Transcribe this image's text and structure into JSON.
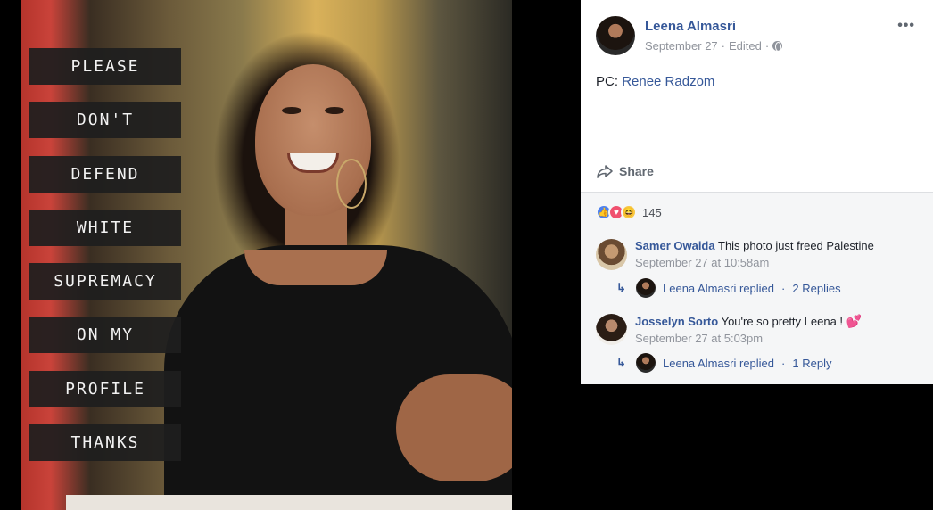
{
  "photo": {
    "overlay_words": [
      "PLEASE",
      "DON'T",
      "DEFEND",
      "WHITE",
      "SUPREMACY",
      "ON MY",
      "PROFILE",
      "THANKS"
    ]
  },
  "post": {
    "author": "Leena Almasri",
    "date": "September 27",
    "edited": "Edited",
    "separator": "·",
    "caption_prefix": "PC: ",
    "caption_link": "Renee Radzom",
    "more_label": "•••",
    "share_label": "Share"
  },
  "reactions": {
    "count": "145",
    "types": [
      "like-icon",
      "love-icon",
      "haha-icon"
    ]
  },
  "comments": [
    {
      "name": "Samer Owaida",
      "text": "This photo just freed Palestine",
      "time": "September 27 at 10:58am",
      "reply_author": "Leena Almasri replied",
      "reply_sep": "·",
      "reply_count": "2 Replies"
    },
    {
      "name": "Josselyn Sorto",
      "text": "You're so pretty Leena ! ",
      "emoji": "💕",
      "time": "September 27 at 5:03pm",
      "reply_author": "Leena Almasri replied",
      "reply_sep": "·",
      "reply_count": "1 Reply"
    }
  ],
  "colors": {
    "link": "#365899",
    "meta": "#90949c",
    "panel_bg": "#ffffff",
    "comments_bg": "#f5f6f7"
  }
}
